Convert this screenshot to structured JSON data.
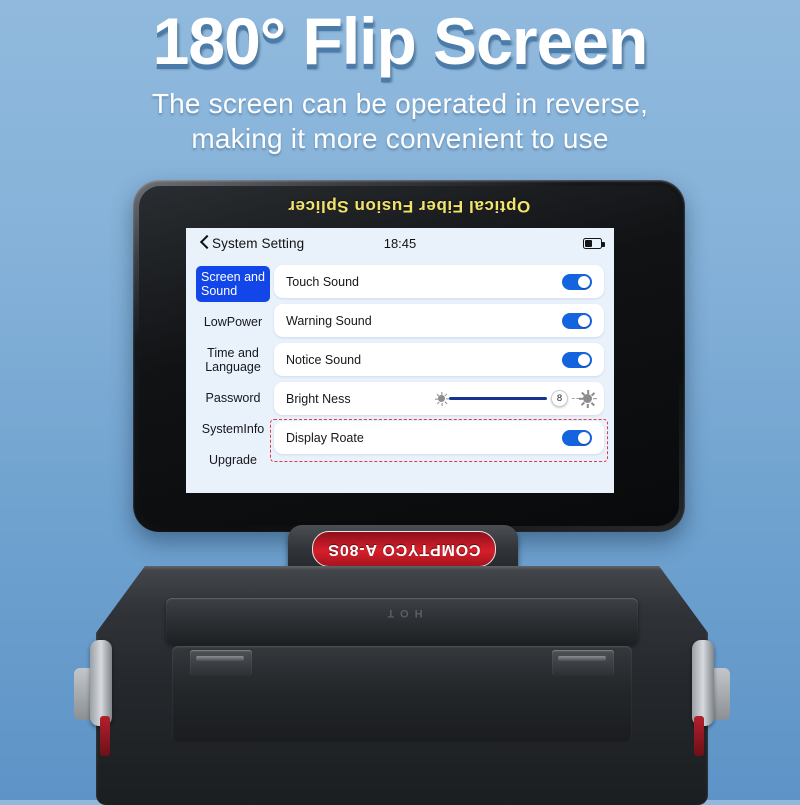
{
  "headline": {
    "title": "180° Flip Screen",
    "subtitle_line1": "The screen can be operated in reverse,",
    "subtitle_line2": "making it more convenient to use"
  },
  "device": {
    "brand_strip": "Optical Fiber Fusion Splicer",
    "badge_text": "COMPTYCO A-80S",
    "hot_label": "HOT",
    "accent_blue": "#1464e0",
    "highlight_red": "#e03a44",
    "brand_yellow": "#f2e46b"
  },
  "screen": {
    "statusbar": {
      "back_label": "System Setting",
      "time": "18:45",
      "battery_icon": "battery-icon"
    },
    "sidebar": {
      "items": [
        {
          "label": "Screen and Sound",
          "selected": true
        },
        {
          "label": "LowPower",
          "selected": false
        },
        {
          "label": "Time and Language",
          "selected": false
        },
        {
          "label": "Password",
          "selected": false
        },
        {
          "label": "SystemInfo",
          "selected": false
        },
        {
          "label": "Upgrade",
          "selected": false
        }
      ]
    },
    "rows": [
      {
        "label": "Touch Sound",
        "type": "toggle",
        "value": "on"
      },
      {
        "label": "Warning Sound",
        "type": "toggle",
        "value": "on"
      },
      {
        "label": "Notice Sound",
        "type": "toggle",
        "value": "on"
      },
      {
        "label": "Bright Ness",
        "type": "slider",
        "value": "8"
      },
      {
        "label": "Display Roate",
        "type": "toggle",
        "value": "on",
        "highlighted": true
      }
    ]
  }
}
